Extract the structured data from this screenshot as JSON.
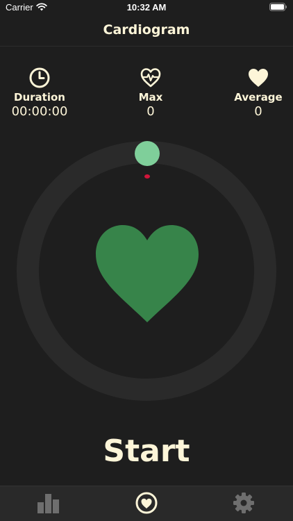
{
  "status_bar": {
    "carrier": "Carrier",
    "time": "10:32 AM"
  },
  "nav": {
    "title": "Cardiogram"
  },
  "stats": {
    "duration": {
      "label": "Duration",
      "value": "00:00:00",
      "icon": "clock-icon"
    },
    "max": {
      "label": "Max",
      "value": "0",
      "icon": "heart-pulse-icon"
    },
    "average": {
      "label": "Average",
      "value": "0",
      "icon": "heart-filled-icon"
    }
  },
  "monitor": {
    "progress": 0,
    "heart_icon": "heart-icon"
  },
  "actions": {
    "start_label": "Start"
  },
  "tabs": [
    {
      "name": "history",
      "icon": "bar-chart-icon",
      "active": false
    },
    {
      "name": "heart",
      "icon": "heart-circle-icon",
      "active": true
    },
    {
      "name": "settings",
      "icon": "gear-icon",
      "active": false
    }
  ],
  "colors": {
    "background": "#1e1e1e",
    "text": "#fdf5d8",
    "heart_green": "#37844a",
    "knob_green": "#7fcf9a",
    "ring": "#2a2a2a",
    "indicator_red": "#d0153a",
    "tab_inactive": "#6e6e6e",
    "tab_active": "#fdf5d8"
  }
}
